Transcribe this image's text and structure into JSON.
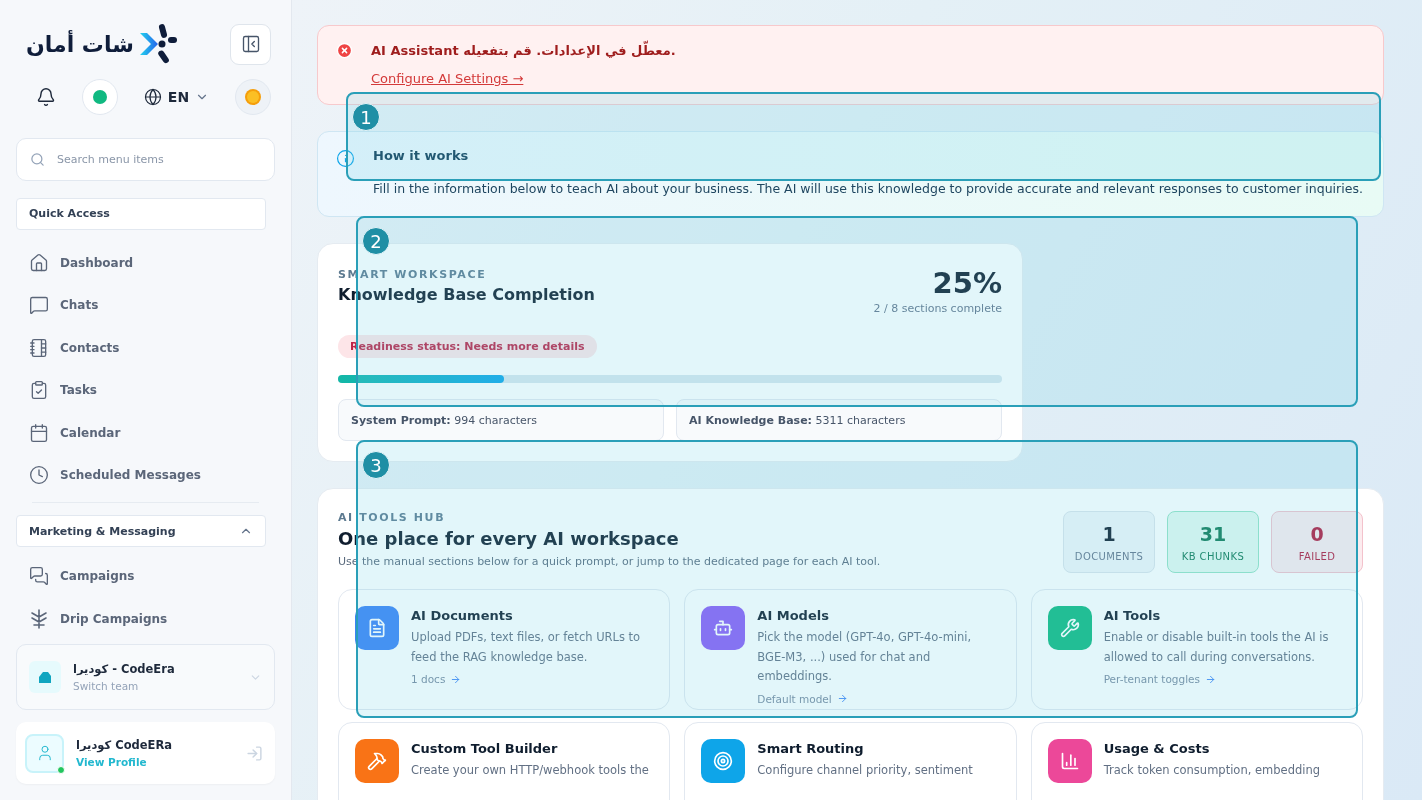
{
  "sidebar": {
    "brand": "شات أمان",
    "status": {
      "online": true
    },
    "language": "EN",
    "search": {
      "placeholder": "Search menu items"
    },
    "quick_access": {
      "title": "Quick Access",
      "items": [
        {
          "label": "Dashboard"
        },
        {
          "label": "Chats"
        },
        {
          "label": "Contacts"
        },
        {
          "label": "Tasks"
        },
        {
          "label": "Calendar"
        },
        {
          "label": "Scheduled Messages"
        }
      ]
    },
    "marketing": {
      "title": "Marketing & Messaging",
      "expanded": true,
      "items": [
        {
          "label": "Campaigns"
        },
        {
          "label": "Drip Campaigns"
        }
      ]
    },
    "team": {
      "name": "كوديرا - CodeEra",
      "action": "Switch team"
    },
    "profile": {
      "name": "كوديرا CodeERa",
      "link": "View Profile",
      "online": true
    }
  },
  "alert": {
    "message": "AI Assistant معطّل في الإعدادات. قم بتفعيله.",
    "link": "Configure AI Settings →"
  },
  "info": {
    "title": "How it works",
    "text": "Fill in the information below to teach AI about your business. The AI will use this knowledge to provide accurate and relevant responses to customer inquiries."
  },
  "completion": {
    "eyebrow": "SMART WORKSPACE",
    "title": "Knowledge Base Completion",
    "percent": "25%",
    "summary": "2 / 8 sections complete",
    "status": "Readiness status: Needs more details",
    "level": 0.25,
    "stats": [
      "**System Prompt:** 994 characters",
      "**AI Knowledge Base:** 5311 characters"
    ]
  },
  "hub": {
    "eyebrow": "AI TOOLS HUB",
    "title": "One place for every AI workspace",
    "subtitle": "Use the manual sections below for a quick prompt, or jump to the dedicated page for each AI tool.",
    "stats": [
      {
        "value": "1",
        "label": "DOCUMENTS",
        "kind": "neutral"
      },
      {
        "value": "31",
        "label": "KB CHUNKS",
        "kind": "success"
      },
      {
        "value": "0",
        "label": "FAILED",
        "kind": "danger"
      }
    ],
    "tools": [
      {
        "title": "AI Documents",
        "description": "Upload PDFs, text files, or fetch URLs to feed the RAG knowledge base.",
        "link": "1 docs"
      },
      {
        "title": "AI Models",
        "description": "Pick the model (GPT-4o, GPT-4o-mini, BGE-M3, ...) used for chat and embeddings.",
        "link": "Default model"
      },
      {
        "title": "AI Tools",
        "description": "Enable or disable built-in tools the AI is allowed to call during conversations.",
        "link": "Per-tenant toggles"
      },
      {
        "title": "Custom Tool Builder",
        "description": "Create your own HTTP/webhook tools the"
      },
      {
        "title": "Smart Routing",
        "description": "Configure channel priority, sentiment"
      },
      {
        "title": "Usage & Costs",
        "description": "Track token consumption, embedding"
      }
    ]
  },
  "highlights": [
    {
      "label": "1"
    },
    {
      "label": "2"
    },
    {
      "label": "3"
    }
  ]
}
